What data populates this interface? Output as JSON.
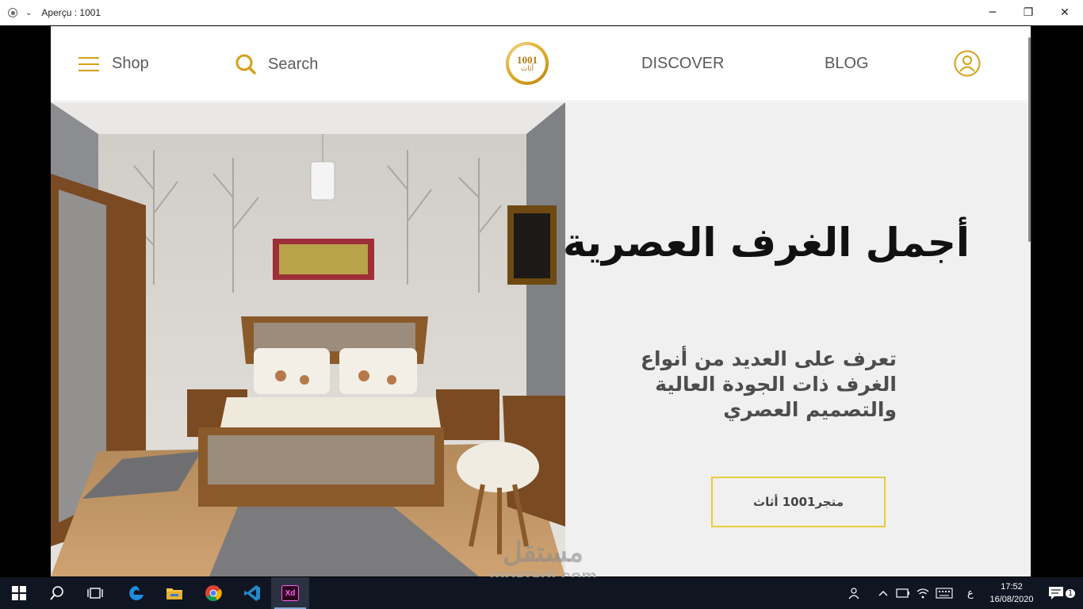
{
  "window": {
    "title": "Aperçu : 1001",
    "controls": {
      "minimize": "─",
      "maximize": "❐",
      "close": "✕"
    }
  },
  "nav": {
    "shop_label": "Shop",
    "search_label": "Search",
    "discover_label": "DISCOVER",
    "blog_label": "BLOG",
    "logo_number": "1001",
    "logo_text": "أثاث",
    "accent_color": "#d4a019"
  },
  "hero": {
    "title": "أجمل الغرف العصرية",
    "text": "تعرف على العديد من أنواع الغرف ذات الجودة العالية والتصميم العصري",
    "cta_label": "متجر1001 أثاث",
    "cta_border_color": "#e8cc3a"
  },
  "watermark": {
    "arabic": "مستقل",
    "latin": "mostaql.com"
  },
  "taskbar": {
    "lang": "ع",
    "time": "17:52",
    "date": "16/08/2020",
    "notification_count": "1"
  }
}
